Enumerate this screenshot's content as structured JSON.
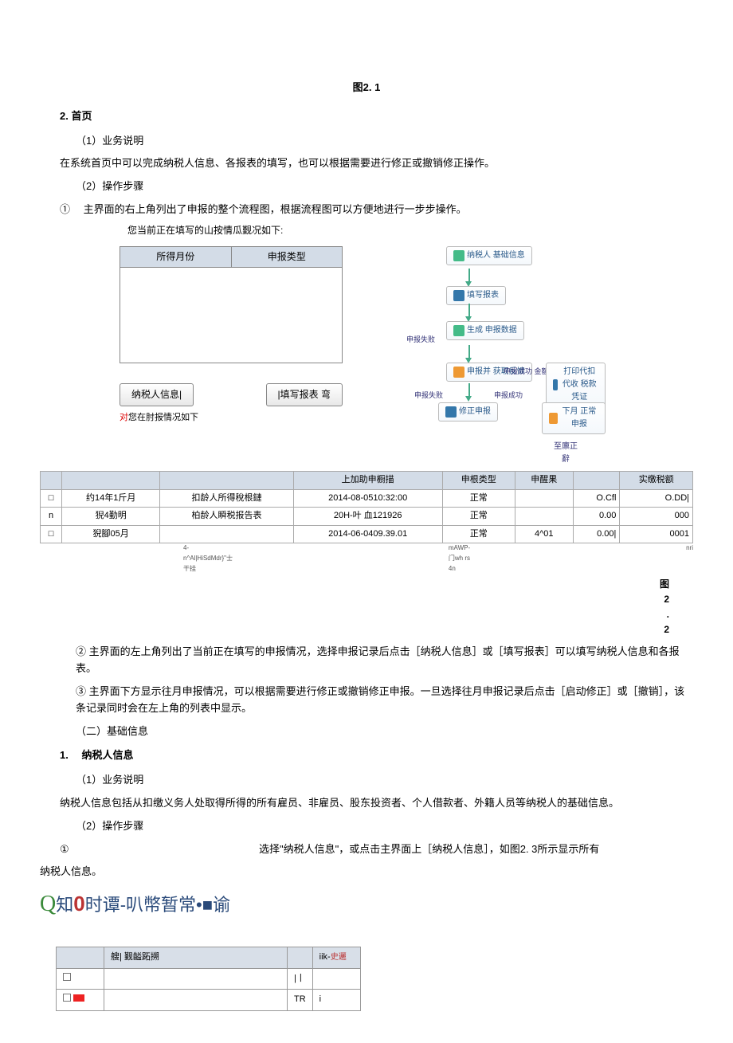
{
  "fig21": "图2. 1",
  "sec2": "2. 首页",
  "p_biz_label": "（1）业务说明",
  "p_biz_desc": "在系统首页中可以完成纳税人信息、各报表的填写，也可以根据需要进行修正或撤销修正操作。",
  "p_ops_label": "（2）操作步骤",
  "step1": "① 　主界面的右上角列出了申报的整个流程图，根据流程图可以方便地进行一步步操作。",
  "sub1": "您当前正在填写的山按情瓜觐况如下:",
  "thead": {
    "c1": "所得月份",
    "c2": "申报类型"
  },
  "btn_taxpayer": "纳税人信息|",
  "btn_fill": "|填写报表 弯",
  "red_note": "对",
  "note_rest": "您在肘报情况如下",
  "flow": {
    "n1": "纳税人\n基础信息",
    "n2": "填写报表",
    "n3": "生成\n申报数据",
    "n4": "申报并\n获取反馈",
    "n5": "修正申报",
    "n6a": "申报成功\n金额扣款",
    "n6": "打印代扣代收\n税款凭证",
    "n7": "下月\n正常申报",
    "lbl_fail": "申报失败",
    "lbl_fail2": "申报失败",
    "lbl_succ": "申报成功",
    "bottom": "至廪正\n辭"
  },
  "hist": {
    "headers": [
      "",
      "",
      "",
      "上加助申橱描",
      "申根类型",
      "申醒果",
      "",
      "实缴税额"
    ],
    "rows": [
      [
        "□",
        "约14年1斤月",
        "扣龄人所得稅根鏈",
        "2014-08-0510:32:00",
        "正常",
        "",
        "O.Cfl",
        "O.DD|"
      ],
      [
        "n",
        "猊4勤明",
        "柏龄人瞬税报告表",
        "20H-叶 血121926",
        "正常",
        "",
        "0.00",
        "000"
      ],
      [
        "□",
        "猊腳05月",
        "",
        "2014-06-0409.39.01",
        "正常",
        "4^01",
        "0.00|",
        "0001"
      ]
    ],
    "foot1": "4-n^Al|HiSdMdr}\"士干挂",
    "foot2": "mAWP-\n门wh rs 4n",
    "foot3": "nri"
  },
  "fig22": {
    "a": "图",
    "b": "2",
    "c": ".",
    "d": "2"
  },
  "step2": "② 主界面的左上角列出了当前正在填写的申报情况，选择申报记录后点击［纳税人信息］或［填写报表］可以填写纳税人信息和各报表。",
  "step3": "③ 主界面下方显示往月申报情况，可以根据需要进行修正或撤销修正申报。一旦选择往月申报记录后点击［启动修正］或［撤销］，该条记录同时会在左上角的列表中显示。",
  "sec_base": "（二）基础信息",
  "sec_tax": "1. 　纳税人信息",
  "tax_desc": "纳税人信息包括从扣缴义务人处取得所得的所有雇员、非雇员、股东投资者、个人借款者、外籍人员等纳税人的基础信息。",
  "tax_step1a": "①",
  "tax_step1b": "选择\"纳税人信息\"，或点击主界面上［纳税人信息］，如图2. 3所示显示所有",
  "tax_step1c": "纳税人信息。",
  "banner": {
    "t1": "知",
    "t2": "时谭-叭幣暂常•■谕"
  },
  "gtable": {
    "h1": "艘| 觐齸跖搠",
    "h2": "iik-",
    "h2s": "史邐",
    "r1c1": "|丨",
    "r2c1": "TR",
    "r2c2": "i"
  }
}
